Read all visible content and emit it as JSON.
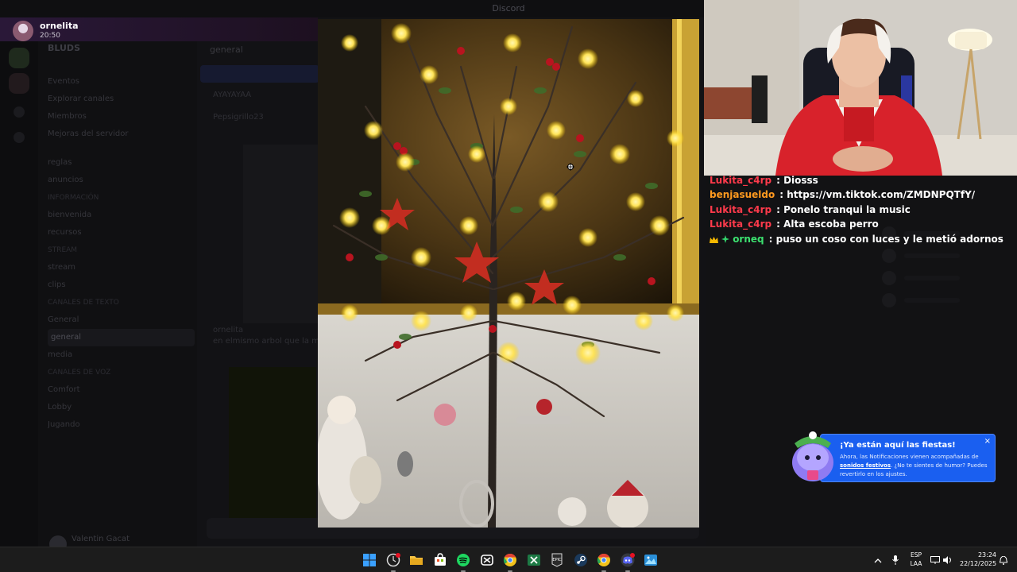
{
  "background_app": {
    "title": "Discord",
    "server_name": "BLUDS",
    "channel_header": "general",
    "channels": [
      "Eventos",
      "Explorar canales",
      "Miembros",
      "Mejoras del servidor",
      "reglas",
      "anuncios",
      "Información",
      "bienvenida",
      "recursos",
      "STREAM",
      "stream",
      "clips",
      "Canales de texto",
      "General",
      "general",
      "media",
      "Canales de voz",
      "Comfort",
      "Lobby",
      "Jugando"
    ],
    "user_name": "Valentin Gacat",
    "chat_ghost_lines": [
      "AYAYAYAA",
      "Pepsigrillo23",
      "ornelita",
      "en elmismo arbol que la mia"
    ]
  },
  "notification": {
    "name": "ornelita",
    "time": "20:50"
  },
  "stream_chat": [
    {
      "user": "Lukita_c4rp",
      "color": "#ff3a4b",
      "text": "Diosss",
      "badges": []
    },
    {
      "user": "benjasueldo",
      "color": "#ff9a1f",
      "text": "https://vm.tiktok.com/ZMDNPQTfY/",
      "badges": []
    },
    {
      "user": "Lukita_c4rp",
      "color": "#ff3a4b",
      "text": "Ponelo tranqui la music",
      "badges": []
    },
    {
      "user": "Lukita_c4rp",
      "color": "#ff3a4b",
      "text": "Alta escoba perro",
      "badges": []
    },
    {
      "user": "orneq",
      "color": "#3ce06f",
      "text": "puso un coso con luces y le metió adornos",
      "badges": [
        "crown-icon",
        "gem-icon"
      ]
    }
  ],
  "toast": {
    "title": "¡Ya están aquí las fiestas!",
    "body_pre": "Ahora, las Notificaciones vienen acompañadas de ",
    "body_link": "sonidos festivos",
    "body_post": ". ¿No te sientes de humor? Puedes revertirlo en los ajustes.",
    "close": "×"
  },
  "taskbar": {
    "apps": [
      {
        "name": "windows-start-icon",
        "color": "#3aa0ff",
        "running": false
      },
      {
        "name": "clock-app-icon",
        "color": "#d9d9d9",
        "running": true
      },
      {
        "name": "file-explorer-icon",
        "color": "#f5c344",
        "running": false
      },
      {
        "name": "store-icon",
        "color": "#ffffff",
        "running": false
      },
      {
        "name": "spotify-icon",
        "color": "#1ed760",
        "running": true
      },
      {
        "name": "capcut-icon",
        "color": "#ffffff",
        "running": false
      },
      {
        "name": "chrome-icon",
        "color": "#e34133",
        "running": true
      },
      {
        "name": "excel-icon",
        "color": "#1d7a45",
        "running": false
      },
      {
        "name": "epic-games-icon",
        "color": "#2b2b2b",
        "running": false
      },
      {
        "name": "steam-icon",
        "color": "#1b3a5c",
        "running": false
      },
      {
        "name": "chrome-icon-2",
        "color": "#e34133",
        "running": true
      },
      {
        "name": "discord-icon",
        "color": "#5865f2",
        "running": true
      },
      {
        "name": "photos-icon",
        "color": "#2a8fd8",
        "running": false
      }
    ],
    "lang_top": "ESP",
    "lang_bottom": "LAA",
    "time": "23:24",
    "date": "22/12/2025"
  }
}
